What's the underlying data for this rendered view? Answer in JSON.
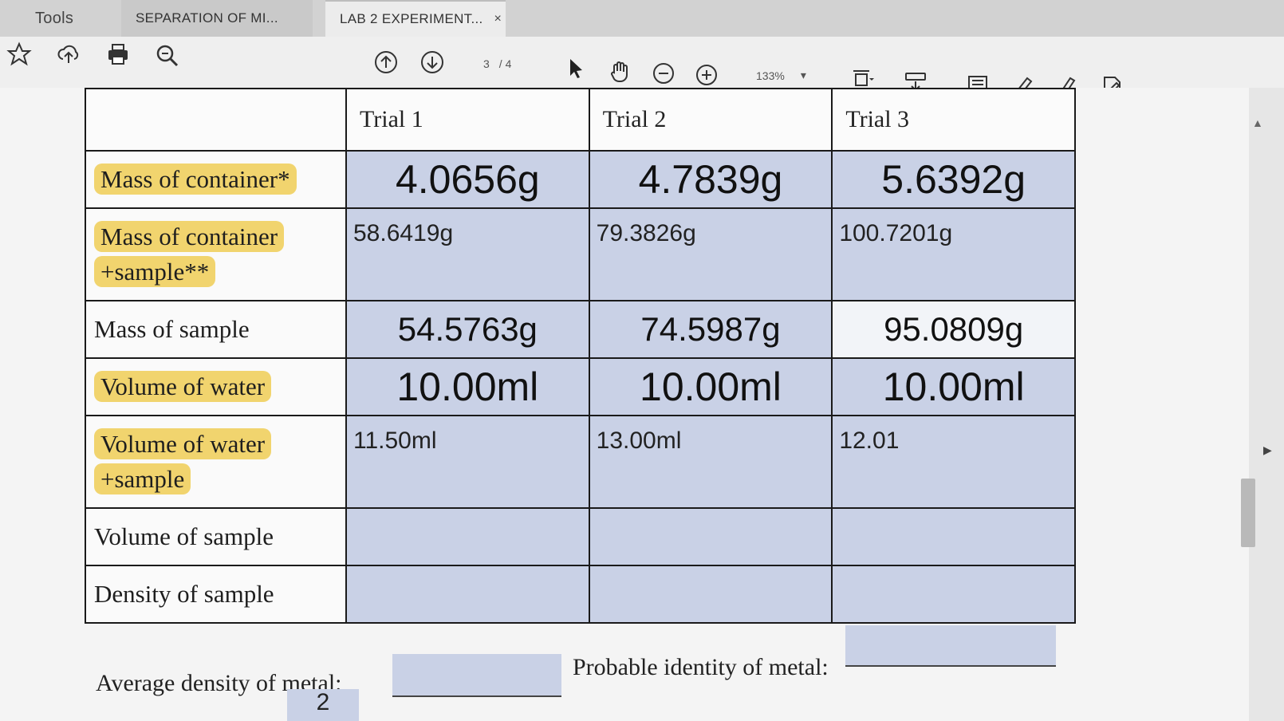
{
  "tabs": {
    "menu_label": "Tools",
    "tab1_label": "SEPARATION OF MI...",
    "tab2_label": "LAB 2 EXPERIMENT...",
    "close_symbol": "×"
  },
  "toolbar": {
    "icons": [
      "star-icon",
      "cloud-upload-icon",
      "print-icon",
      "zoom-search-icon",
      "page-up-icon",
      "page-down-icon",
      "select-cursor-icon",
      "hand-tool-icon",
      "zoom-out-icon",
      "zoom-in-icon",
      "fit-page-icon",
      "read-mode-icon",
      "comment-icon",
      "highlight-pen-icon",
      "sign-icon",
      "edit-pdf-icon"
    ],
    "page_current": "3",
    "page_total": "/ 4",
    "zoom_value": "133%"
  },
  "table": {
    "headers": [
      "",
      "Trial 1",
      "Trial 2",
      "Trial 3"
    ],
    "rows": [
      {
        "label": "Mass of container*",
        "highlight": true,
        "values": [
          "4.0656g",
          "4.7839g",
          "5.6392g"
        ]
      },
      {
        "label": "Mass of container +sample**",
        "highlight": true,
        "values": [
          "58.6419g",
          "79.3826g",
          "100.7201g"
        ]
      },
      {
        "label": "Mass of sample",
        "highlight": false,
        "values": [
          "54.5763g",
          "74.5987g",
          "95.0809g"
        ]
      },
      {
        "label": "Volume of water",
        "highlight": true,
        "values": [
          "10.00ml",
          "10.00ml",
          "10.00ml"
        ]
      },
      {
        "label": "Volume of water +sample",
        "highlight": true,
        "values": [
          "11.50ml",
          "13.00ml",
          "12.01"
        ]
      },
      {
        "label": "Volume of sample",
        "highlight": false,
        "values": [
          "",
          "",
          ""
        ]
      },
      {
        "label": "Density of sample",
        "highlight": false,
        "values": [
          "",
          "",
          ""
        ]
      }
    ]
  },
  "bottom": {
    "avg_label": "Average density of metal:",
    "avg_value": "",
    "identity_label": "Probable identity of metal:",
    "identity_value": "",
    "partial_digit": "2"
  },
  "colors": {
    "highlight": "#f1d46e",
    "field_fill": "#c9d1e6"
  }
}
